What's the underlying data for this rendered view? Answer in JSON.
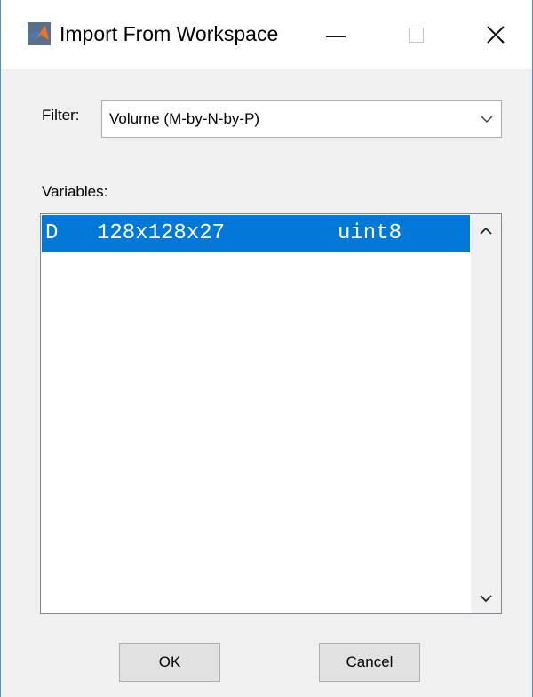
{
  "window": {
    "title": "Import From Workspace",
    "icons": {
      "app": "matlab-logo-icon",
      "minimize": "minimize-icon",
      "maximize": "maximize-icon",
      "close": "close-icon"
    }
  },
  "filter": {
    "label": "Filter:",
    "selected": "Volume (M-by-N-by-P)"
  },
  "variables": {
    "label": "Variables:",
    "items": [
      {
        "name": "D",
        "size": "128x128x27",
        "class": "uint8",
        "selected": true
      }
    ]
  },
  "buttons": {
    "ok": "OK",
    "cancel": "Cancel"
  },
  "colors": {
    "selection": "#0078d7",
    "window_border": "#4a8cd8"
  }
}
